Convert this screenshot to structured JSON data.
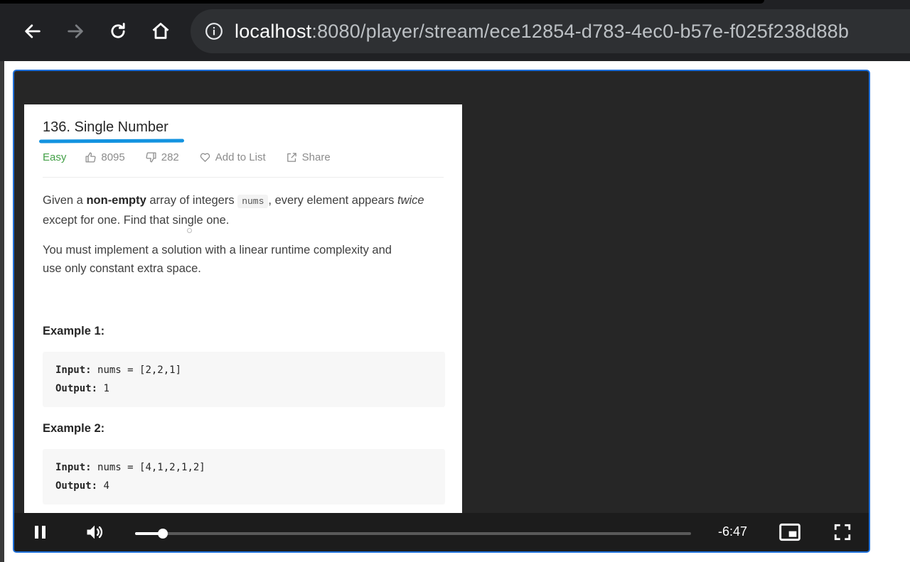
{
  "browser": {
    "url_host": "localhost",
    "url_rest": ":8080/player/stream/ece12854-d783-4ec0-b57e-f025f238d88b"
  },
  "problem": {
    "title": "136. Single Number",
    "difficulty": "Easy",
    "likes": "8095",
    "dislikes": "282",
    "add_to_list": "Add to List",
    "share": "Share",
    "desc1": {
      "pre": "Given a ",
      "bold": "non-empty",
      "mid": " array of integers ",
      "code": "nums",
      "post": ", every element appears ",
      "italic": "twice",
      "line2": "except for one. Find that single one."
    },
    "desc2": {
      "line1": "You must implement a solution with a linear runtime complexity and",
      "line2": "use only constant extra space."
    },
    "examples": [
      {
        "heading": "Example 1:",
        "input_label": "Input:",
        "input": "nums = [2,2,1]",
        "output_label": "Output:",
        "output": "1"
      },
      {
        "heading": "Example 2:",
        "input_label": "Input:",
        "input": "nums = [4,1,2,1,2]",
        "output_label": "Output:",
        "output": "4"
      }
    ]
  },
  "player": {
    "time_remaining": "-6:47",
    "progress": 0.05
  },
  "colors": {
    "accent": "#1e6fd9",
    "underline": "#1393e0",
    "easy": "#43a047"
  },
  "icons": {
    "back": "back-arrow-icon",
    "forward": "forward-arrow-icon",
    "reload": "reload-icon",
    "home": "home-icon",
    "info": "info-icon",
    "like": "thumbs-up-icon",
    "dislike": "thumbs-down-icon",
    "heart": "heart-icon",
    "share": "share-icon",
    "pause": "pause-icon",
    "volume": "volume-icon",
    "pip": "picture-in-picture-icon",
    "fullscreen": "fullscreen-icon"
  }
}
